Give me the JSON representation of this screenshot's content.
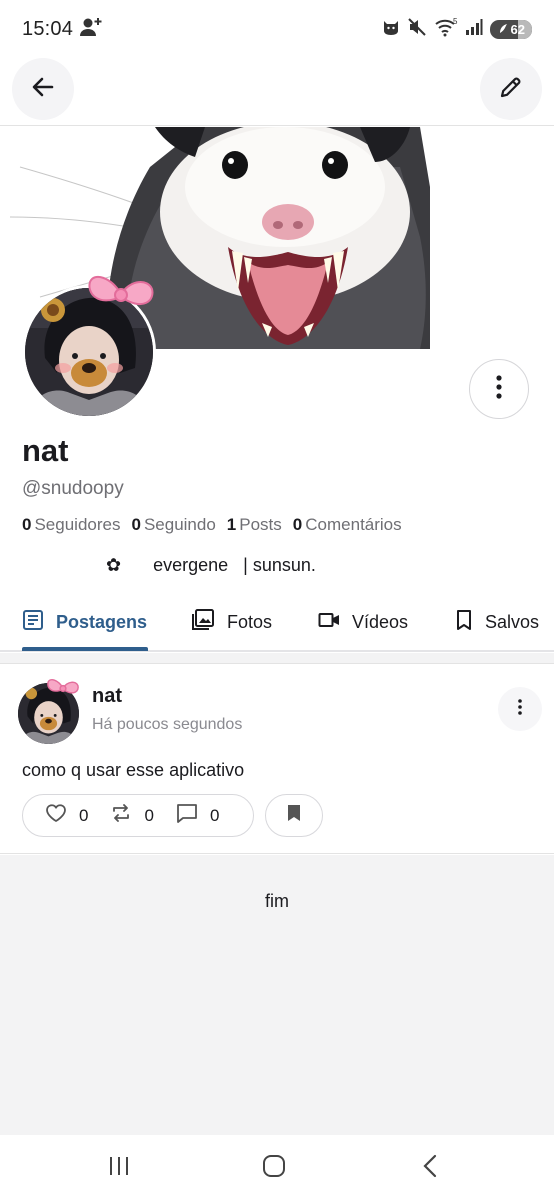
{
  "status_bar": {
    "time": "15:04",
    "battery": "62",
    "icons": [
      "add-person-icon",
      "cat-icon",
      "mute-icon",
      "wifi-icon",
      "signal-icon",
      "battery-icon"
    ]
  },
  "app_bar": {
    "back_icon": "arrow-left-icon",
    "edit_icon": "pencil-icon"
  },
  "profile": {
    "display_name": "nat",
    "username": "@snudoopy",
    "stats": [
      {
        "count": "0",
        "label": "Seguidores"
      },
      {
        "count": "0",
        "label": "Seguindo"
      },
      {
        "count": "1",
        "label": "Posts"
      },
      {
        "count": "0",
        "label": "Comentários"
      }
    ],
    "bio_symbol": "✿",
    "bio_text": "evergene   | sunsun."
  },
  "tabs": [
    {
      "label": "Postagens",
      "icon": "article-icon",
      "active": true
    },
    {
      "label": "Fotos",
      "icon": "photos-icon",
      "active": false
    },
    {
      "label": "Vídeos",
      "icon": "video-icon",
      "active": false
    },
    {
      "label": "Salvos",
      "icon": "bookmark-icon",
      "active": false
    }
  ],
  "post": {
    "author": "nat",
    "time": "Há poucos segundos",
    "text": "como q usar esse aplicativo",
    "likes": "0",
    "reposts": "0",
    "comments": "0"
  },
  "end_text": "fim",
  "colors": {
    "accent": "#2f5e8c",
    "muted_text": "#6f6f74",
    "divider": "#e3e3e3",
    "end_background": "#f3f3f4"
  }
}
